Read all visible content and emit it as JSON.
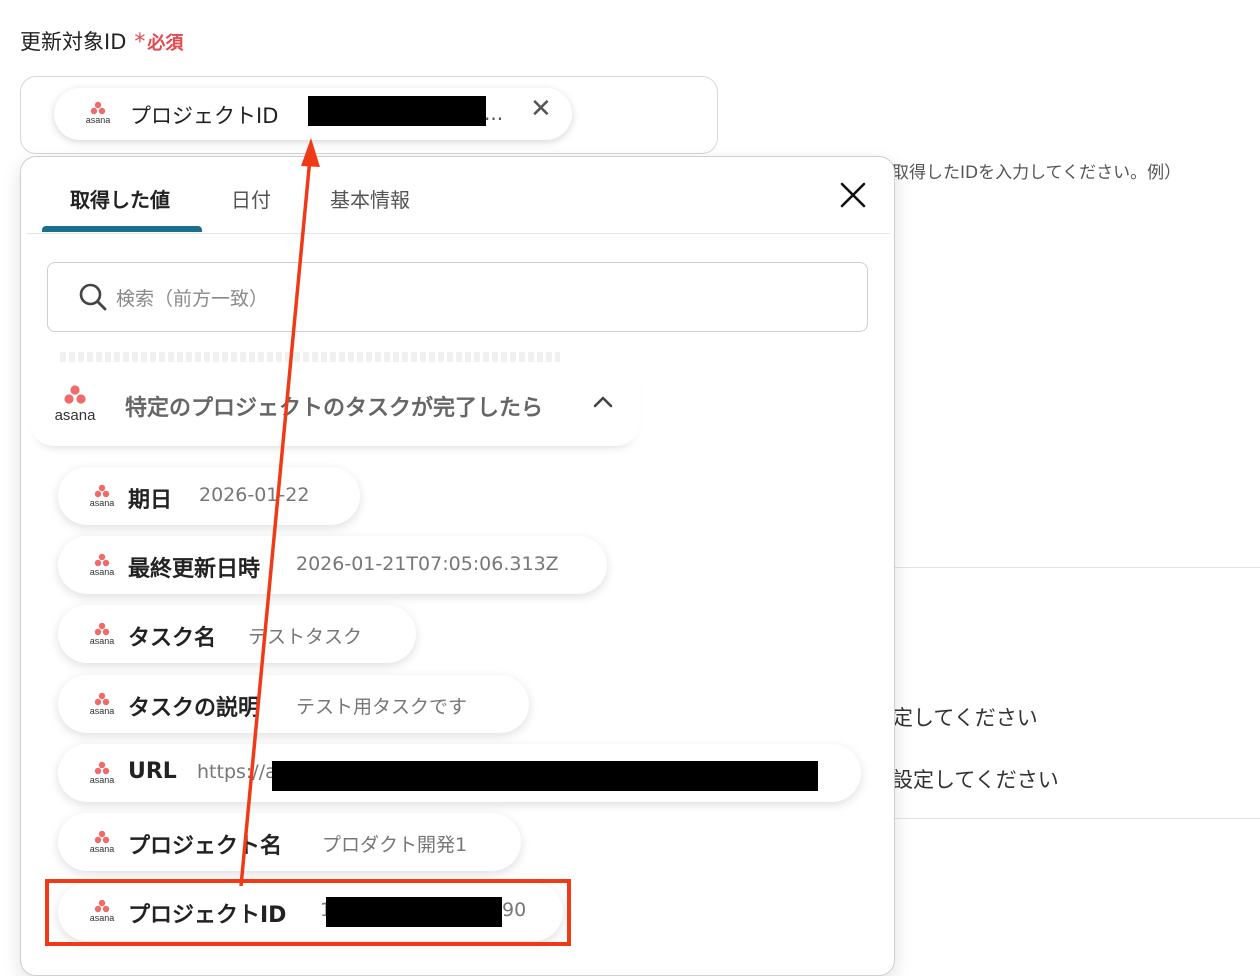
{
  "field": {
    "label": "更新対象ID",
    "required_star": "*",
    "required_text": "必須"
  },
  "selected_chip": {
    "label": "プロジェクトID",
    "ellipsis": "...",
    "remove_icon": "close-icon"
  },
  "background": {
    "hint": "取得したIDを入力してください。例）",
    "text1": "定してください",
    "text2": "設定してください"
  },
  "panel": {
    "tabs": [
      {
        "label": "取得した値",
        "active": true
      },
      {
        "label": "日付"
      },
      {
        "label": "基本情報"
      }
    ],
    "close_icon": "close-icon",
    "search": {
      "placeholder": "検索（前方一致）",
      "icon": "search-icon"
    },
    "group": {
      "app": "asana",
      "title": "特定のプロジェクトのタスクが完了したら",
      "chevron": "chevron-up-icon"
    },
    "rows": [
      {
        "key": "期日",
        "value": "2026-01-22"
      },
      {
        "key": "最終更新日時",
        "value": "2026-01-21T07:05:06.313Z"
      },
      {
        "key": "タスク名",
        "value": "テストタスク"
      },
      {
        "key": "タスクの説明",
        "value": "テスト用タスクです"
      },
      {
        "key": "URL",
        "value": "https://a"
      },
      {
        "key": "プロジェクト名",
        "value": "プロダクト開発1"
      },
      {
        "key": "プロジェクトID",
        "value": "1",
        "value_tail": "90"
      }
    ]
  },
  "colors": {
    "accent_tab": "#1c6f8a",
    "required": "#e5484d",
    "annotation": "#f03a17",
    "asana_logo": "#f06a6a"
  }
}
